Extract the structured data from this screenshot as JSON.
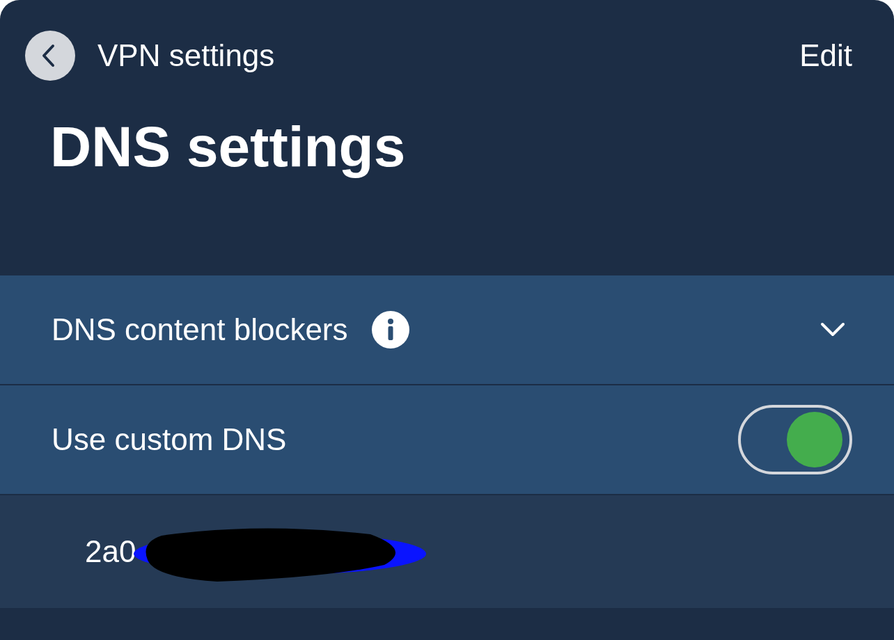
{
  "nav": {
    "back_label": "VPN settings",
    "edit": "Edit"
  },
  "title": "DNS settings",
  "sections": [
    {
      "kind": "expander",
      "label": "DNS content blockers",
      "info": true,
      "expanded": false
    },
    {
      "kind": "toggle",
      "label": "Use custom DNS",
      "on": true
    }
  ],
  "servers": [
    {
      "address": "2a0"
    }
  ]
}
